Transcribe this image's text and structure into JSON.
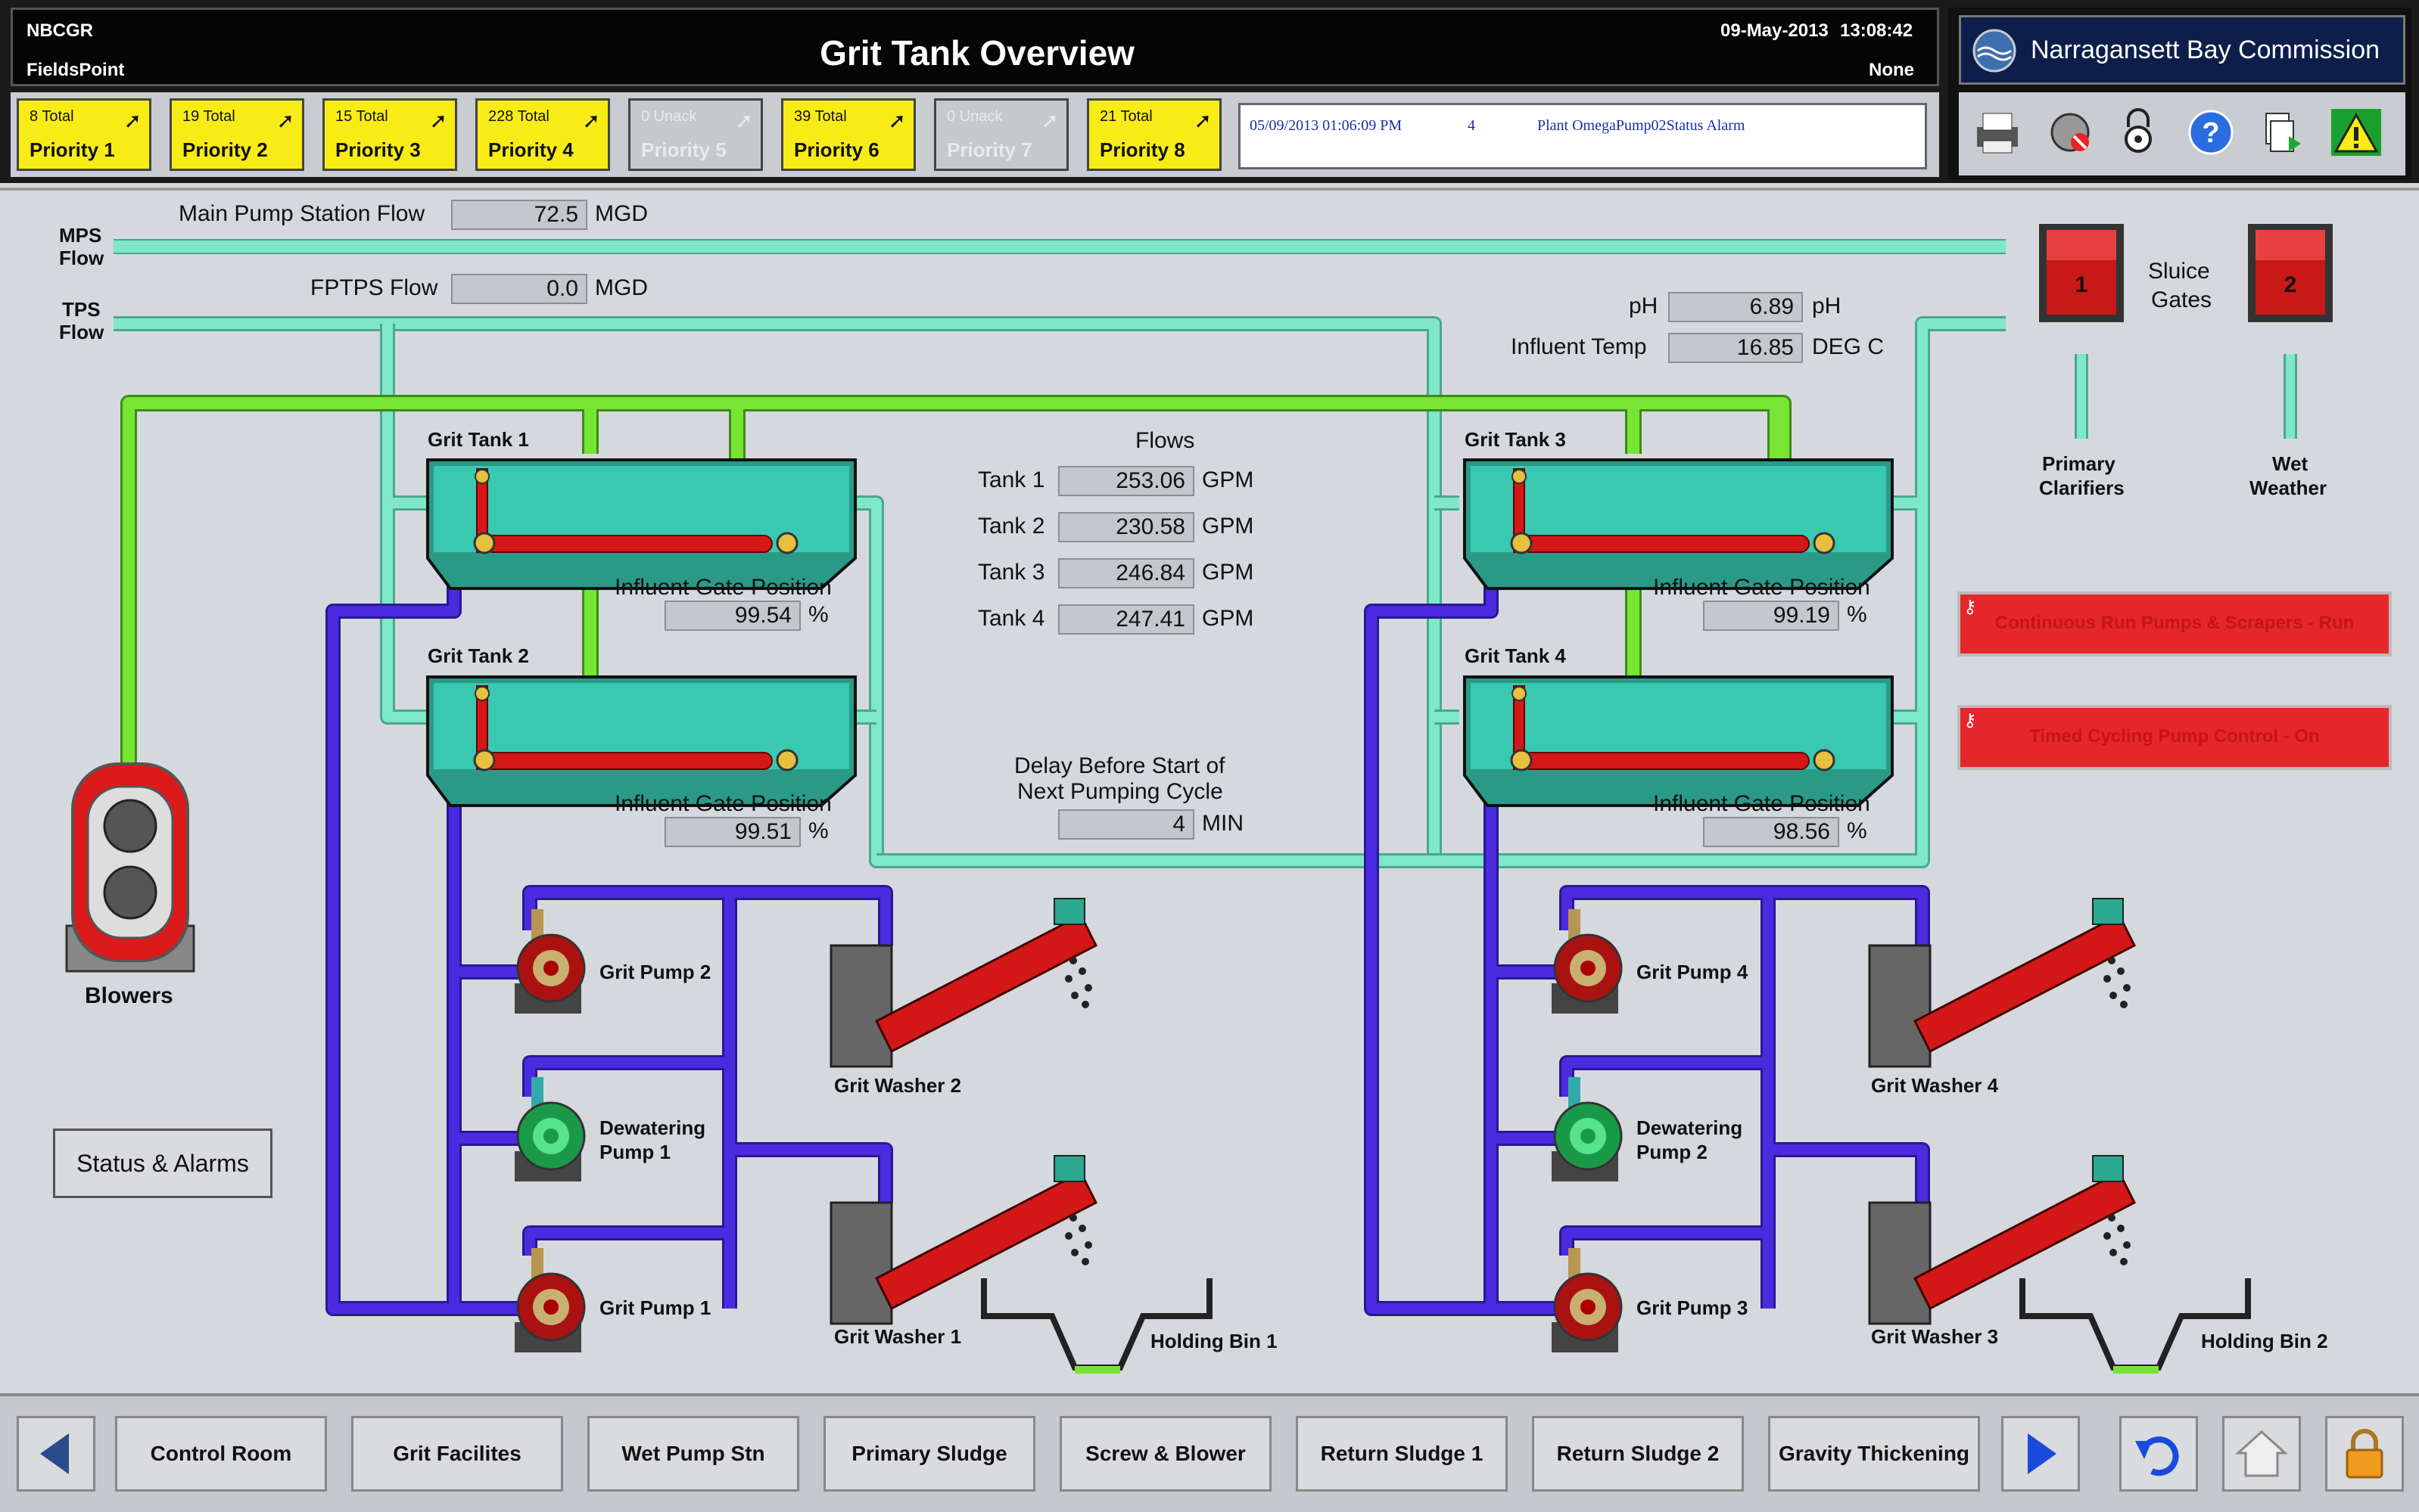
{
  "header": {
    "site_code": "NBCGR",
    "site_name": "FieldsPoint",
    "page_title": "Grit Tank Overview",
    "date": "09-May-2013",
    "time": "13:08:42",
    "user": "None",
    "org_name": "Narragansett Bay Commission"
  },
  "priorities": [
    {
      "total": "8 Total",
      "label": "Priority 1",
      "active": true
    },
    {
      "total": "19 Total",
      "label": "Priority 2",
      "active": true
    },
    {
      "total": "15 Total",
      "label": "Priority 3",
      "active": true
    },
    {
      "total": "228 Total",
      "label": "Priority 4",
      "active": true
    },
    {
      "total": "0 Unack",
      "label": "Priority 5",
      "active": false
    },
    {
      "total": "39 Total",
      "label": "Priority 6",
      "active": true
    },
    {
      "total": "0 Unack",
      "label": "Priority 7",
      "active": false
    },
    {
      "total": "21 Total",
      "label": "Priority 8",
      "active": true
    }
  ],
  "alarm_line": {
    "timestamp": "05/09/2013 01:06:09 PM",
    "priority": "4",
    "message": "Plant OmegaPump02Status Alarm"
  },
  "toolbar_icons": [
    "printer-icon",
    "silence-alarm-icon",
    "lock-settings-icon",
    "help-icon",
    "report-icon",
    "warning-icon"
  ],
  "flows": {
    "mps_label_1": "MPS",
    "mps_label_2": "Flow",
    "tps_label_1": "TPS",
    "tps_label_2": "Flow",
    "main_pump_label": "Main Pump Station Flow",
    "main_pump_value": "72.5",
    "main_pump_unit": "MGD",
    "fptps_label": "FPTPS Flow",
    "fptps_value": "0.0",
    "fptps_unit": "MGD",
    "ph_label": "pH",
    "ph_value": "6.89",
    "ph_unit": "pH",
    "temp_label": "Influent Temp",
    "temp_value": "16.85",
    "temp_unit": "DEG C"
  },
  "sluice": {
    "title_1": "Sluice",
    "title_2": "Gates",
    "gate1": "1",
    "gate2": "2",
    "primary_1": "Primary",
    "primary_2": "Clarifiers",
    "wet_1": "Wet",
    "wet_2": "Weather"
  },
  "tanks_flow": {
    "title": "Flows",
    "unit": "GPM",
    "rows": [
      {
        "label": "Tank 1",
        "value": "253.06"
      },
      {
        "label": "Tank 2",
        "value": "230.58"
      },
      {
        "label": "Tank 3",
        "value": "246.84"
      },
      {
        "label": "Tank 4",
        "value": "247.41"
      }
    ]
  },
  "delay": {
    "line1": "Delay Before Start of",
    "line2": "Next Pumping Cycle",
    "value": "4",
    "unit": "MIN"
  },
  "tanks": [
    {
      "name": "Grit Tank 1",
      "gate_label": "Influent Gate Position",
      "gate_value": "99.54",
      "unit": "%"
    },
    {
      "name": "Grit Tank 2",
      "gate_label": "Influent Gate Position",
      "gate_value": "99.51",
      "unit": "%"
    },
    {
      "name": "Grit Tank 3",
      "gate_label": "Influent Gate Position",
      "gate_value": "99.19",
      "unit": "%"
    },
    {
      "name": "Grit Tank 4",
      "gate_label": "Influent Gate Position",
      "gate_value": "98.56",
      "unit": "%"
    }
  ],
  "equipment": {
    "grit_pump_2": "Grit Pump 2",
    "dewatering_1_a": "Dewatering",
    "dewatering_1_b": "Pump 1",
    "grit_pump_1": "Grit Pump 1",
    "grit_washer_2": "Grit Washer 2",
    "grit_washer_1": "Grit Washer 1",
    "holding_bin_1": "Holding Bin 1",
    "grit_pump_4": "Grit Pump 4",
    "dewatering_2_a": "Dewatering",
    "dewatering_2_b": "Pump 2",
    "grit_pump_3": "Grit Pump 3",
    "grit_washer_4": "Grit Washer 4",
    "grit_washer_3": "Grit Washer 3",
    "holding_bin_2": "Holding Bin 2",
    "blowers": "Blowers"
  },
  "controls": {
    "continuous_run": "Continuous Run Pumps & Scrapers - Run",
    "timed_cycling": "Timed Cycling Pump Control - On",
    "status_alarms": "Status & Alarms"
  },
  "nav": {
    "buttons": [
      "Control Room",
      "Grit Facilites",
      "Wet Pump Stn",
      "Primary Sludge",
      "Screw & Blower",
      "Return Sludge 1",
      "Return Sludge 2",
      "Gravity Thickening"
    ]
  },
  "colors": {
    "air_line": "#77e533",
    "water_line": "#7fe8c8",
    "sludge_line": "#4a2be0",
    "tank_fill": "#38c9b0",
    "alarm_yellow": "#f7ec16",
    "alarm_red": "#e5262b"
  }
}
